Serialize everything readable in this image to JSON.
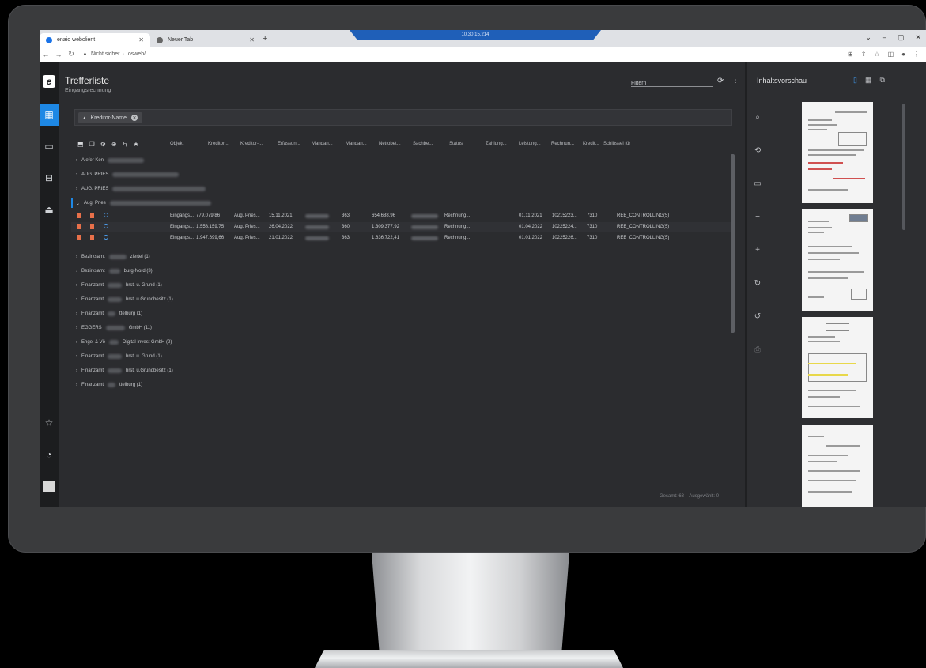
{
  "browser": {
    "tabs": [
      {
        "label": "enaio webclient",
        "active": true
      },
      {
        "label": "Neuer Tab",
        "active": false
      }
    ],
    "window_title": "10.30.15.214",
    "url_warning": "Nicht sicher",
    "url_path": "osweb/"
  },
  "app": {
    "title": "Trefferliste",
    "subtitle": "Eingangsrechnung",
    "filter_placeholder": "Filtern",
    "group_chip": "Kreditor-Name",
    "columns": [
      "Objekt",
      "Kreditor...",
      "Kreditor-...",
      "Erfassun...",
      "Mandan...",
      "Mandan...",
      "Nettobet...",
      "Sachbe...",
      "Status",
      "Zahlung...",
      "Leistung...",
      "Rechnun...",
      "Kredit...",
      "Schlüssel für"
    ],
    "groups_top": [
      {
        "label": "Aiefer Ken"
      },
      {
        "label": "AUG. PRIES"
      },
      {
        "label": "AUG. PRIES"
      },
      {
        "label": "Aug. Pries"
      }
    ],
    "rows": [
      {
        "objekt": "Eingangs...",
        "amount": "779.079,86",
        "kreditor": "Aug. Pries...",
        "date": "15.11.2021",
        "mandant": "363",
        "netto": "654.688,96",
        "status": "Rechnung...",
        "leistung": "01.11.2021",
        "rechnung": "10215223...",
        "kredit": "7310",
        "schluessel": "REB_CONTROLLING(5)"
      },
      {
        "objekt": "Eingangs...",
        "amount": "1.558.159,75",
        "kreditor": "Aug. Pries...",
        "date": "26.04.2022",
        "mandant": "360",
        "netto": "1.309.377,92",
        "status": "Rechnung...",
        "leistung": "01.04.2022",
        "rechnung": "10225224...",
        "kredit": "7310",
        "schluessel": "REB_CONTROLLING(5)"
      },
      {
        "objekt": "Eingangs...",
        "amount": "1.947.699,66",
        "kreditor": "Aug. Pries...",
        "date": "21.01.2022",
        "mandant": "363",
        "netto": "1.636.722,41",
        "status": "Rechnung...",
        "leistung": "01.01.2022",
        "rechnung": "10225226...",
        "kredit": "7310",
        "schluessel": "REB_CONTROLLING(5)"
      }
    ],
    "groups_bottom": [
      {
        "label": "Bezirksamt",
        "tail": "ziertel (1)"
      },
      {
        "label": "Bezirksamt",
        "tail": "burg-Nord (3)"
      },
      {
        "label": "Finanzamt",
        "tail": "hrst. u. Grund (1)"
      },
      {
        "label": "Finanzamt",
        "tail": "hrst. u.Grundbesitz (1)"
      },
      {
        "label": "Finanzamt",
        "tail": "ttelburg (1)"
      },
      {
        "label": "EGGERS",
        "tail": "GmbH (11)"
      },
      {
        "label": "Engel & Vö",
        "tail": "Digital Invest GmbH (2)"
      },
      {
        "label": "Finanzamt",
        "tail": "hrst. u. Grund (1)"
      },
      {
        "label": "Finanzamt",
        "tail": "hrst. u.Grundbesitz (1)"
      },
      {
        "label": "Finanzamt",
        "tail": "ttelburg (1)"
      }
    ],
    "footer_total": "Gesamt: 63",
    "footer_selected": "Ausgewählt: 0"
  },
  "preview": {
    "title": "Inhaltsvorschau"
  },
  "colors": {
    "accent": "#1e88e5",
    "orange_icon": "#e8704a",
    "background": "#2b2c2f"
  }
}
